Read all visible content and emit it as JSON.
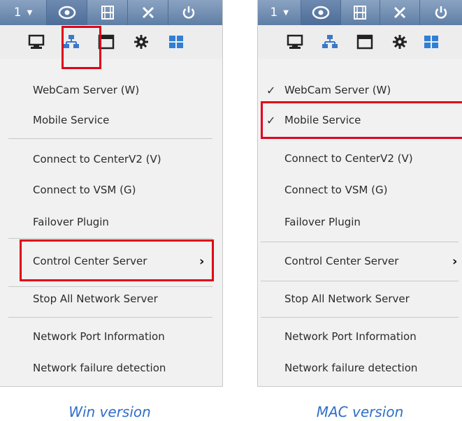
{
  "windows": {
    "toolbar_number": "1",
    "menu": {
      "items": [
        {
          "label": "WebCam Server (W)"
        },
        {
          "label": "Mobile Service"
        },
        {
          "label": "Connect to CenterV2 (V)"
        },
        {
          "label": "Connect to VSM (G)"
        },
        {
          "label": "Failover Plugin"
        },
        {
          "label": "Control Center Server",
          "arrow": "›"
        },
        {
          "label": "Stop All Network Server"
        },
        {
          "label": "Network Port Information"
        },
        {
          "label": "Network failure detection"
        }
      ]
    },
    "caption": "Win version"
  },
  "mac": {
    "toolbar_number": "1",
    "menu": {
      "items": [
        {
          "label": "WebCam Server (W)",
          "checked": true
        },
        {
          "label": "Mobile Service",
          "checked": true
        },
        {
          "label": "Connect to CenterV2 (V)"
        },
        {
          "label": "Connect to VSM (G)"
        },
        {
          "label": "Failover Plugin"
        },
        {
          "label": "Control Center Server",
          "arrow": "›"
        },
        {
          "label": "Stop All Network Server"
        },
        {
          "label": "Network Port Information"
        },
        {
          "label": "Network failure detection"
        }
      ]
    },
    "caption": "MAC version"
  },
  "check_mark": "✓",
  "toolbar_icons": [
    "dropdown-caret-icon",
    "eye-icon",
    "film-icon",
    "tools-icon",
    "power-icon"
  ],
  "submenu_icons": [
    "monitor-icon",
    "network-icon",
    "window-icon",
    "gear-icon",
    "windows-grid-icon"
  ],
  "colors": {
    "toolbar": "#6f8db3",
    "menu_background": "#f1f1f1",
    "highlight": "#e0001b",
    "caption": "#2f6fc6",
    "network_icon": "#3c78c8"
  }
}
